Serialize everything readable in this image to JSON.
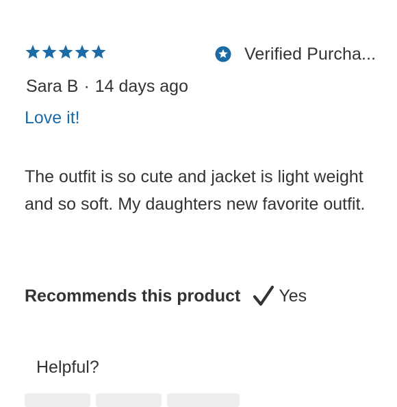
{
  "review": {
    "rating": 5,
    "rating_max": 5,
    "star_color": "#1b6aa5",
    "verified_icon": "star-badge-icon",
    "verified_text": "Verified Purcha...",
    "author": "Sara B",
    "separator": "·",
    "date": "14 days ago",
    "title": "Love it!",
    "title_color": "#1b6aa5",
    "body": "The outfit is so cute and jacket is light weight and so soft. My daughters new favorite outfit.",
    "recommend_label": "Recommends this product",
    "recommend_icon": "checkmark-icon",
    "recommend_value": "Yes",
    "helpful_label": "Helpful?"
  }
}
